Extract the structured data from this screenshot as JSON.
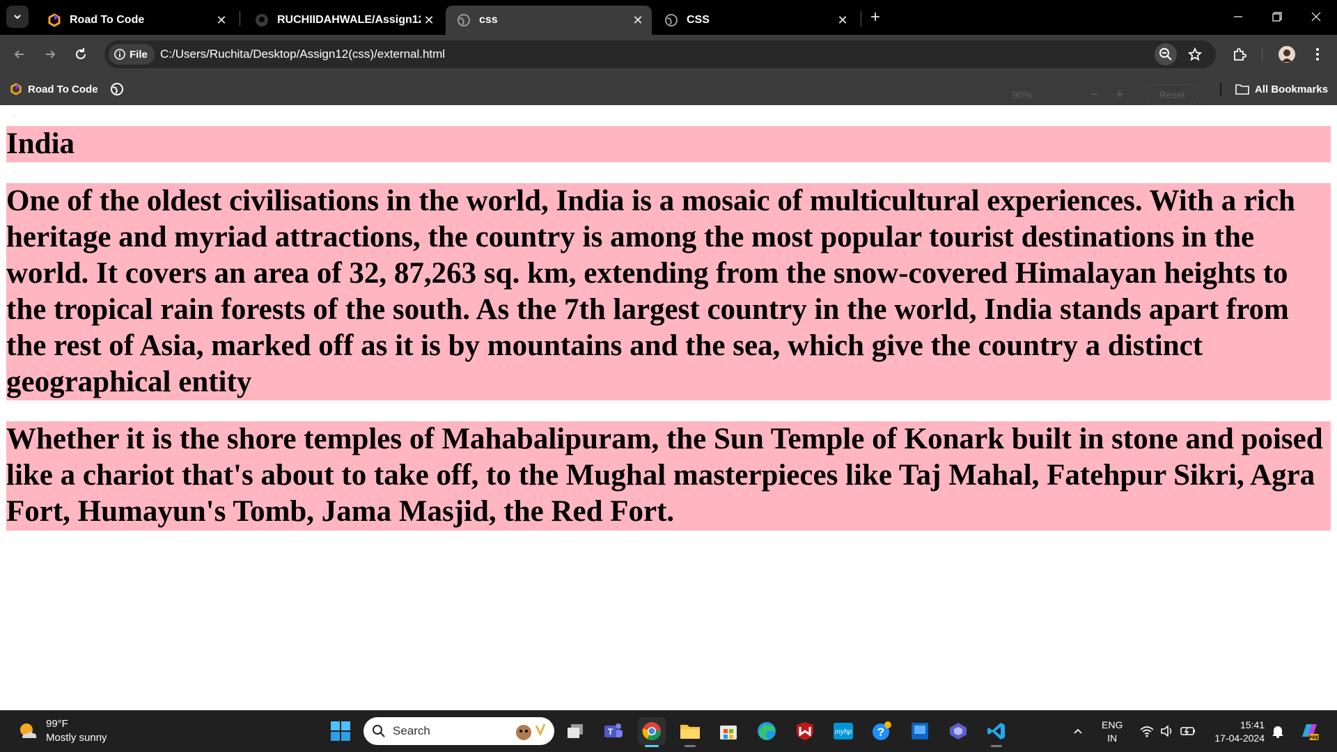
{
  "browser": {
    "tabs": [
      {
        "title": "Road To Code",
        "icon": "road-to-code-icon",
        "active": false
      },
      {
        "title": "RUCHIIDAHWALE/Assign12-css",
        "icon": "github-icon",
        "active": false
      },
      {
        "title": "css",
        "icon": "globe-icon",
        "active": true
      },
      {
        "title": "CSS",
        "icon": "globe-icon",
        "active": false
      }
    ],
    "omnibox": {
      "chip_label": "File",
      "url": "C:/Users/Ruchita/Desktop/Assign12(css)/external.html"
    },
    "bookmarks": {
      "items": [
        {
          "label": "Road To Code",
          "icon": "road-to-code-icon"
        },
        {
          "label": "",
          "icon": "globe-icon"
        }
      ],
      "all_bookmarks_label": "All Bookmarks"
    },
    "zoom_popup": {
      "value": "90%",
      "minus": "−",
      "plus": "+",
      "reset": "Reset"
    }
  },
  "page": {
    "background_highlight": "#ffb6c1",
    "heading": "India",
    "paragraphs": [
      "One of the oldest civilisations in the world, India is a mosaic of multicultural experiences. With a rich heritage and myriad attractions, the country is among the most popular tourist destinations in the world. It covers an area of 32, 87,263 sq. km, extending from the snow-covered Himalayan heights to the tropical rain forests of the south. As the 7th largest country in the world, India stands apart from the rest of Asia, marked off as it is by mountains and the sea, which give the country a distinct geographical entity",
      "Whether it is the shore temples of Mahabalipuram, the Sun Temple of Konark built in stone and poised like a chariot that's about to take off, to the Mughal masterpieces like Taj Mahal, Fatehpur Sikri, Agra Fort, Humayun's Tomb, Jama Masjid, the Red Fort."
    ]
  },
  "taskbar": {
    "weather": {
      "temp": "99°F",
      "condition": "Mostly sunny"
    },
    "search_placeholder": "Search",
    "apps": [
      "start-icon",
      "task-view-icon",
      "teams-icon",
      "chrome-icon",
      "file-explorer-icon",
      "microsoft-store-icon",
      "edge-icon",
      "mcafee-icon",
      "myhp-icon",
      "get-help-icon",
      "app-icon",
      "copilot-icon",
      "vscode-icon"
    ],
    "language": {
      "line1": "ENG",
      "line2": "IN"
    },
    "clock": {
      "time": "15:41",
      "date": "17-04-2024"
    }
  }
}
